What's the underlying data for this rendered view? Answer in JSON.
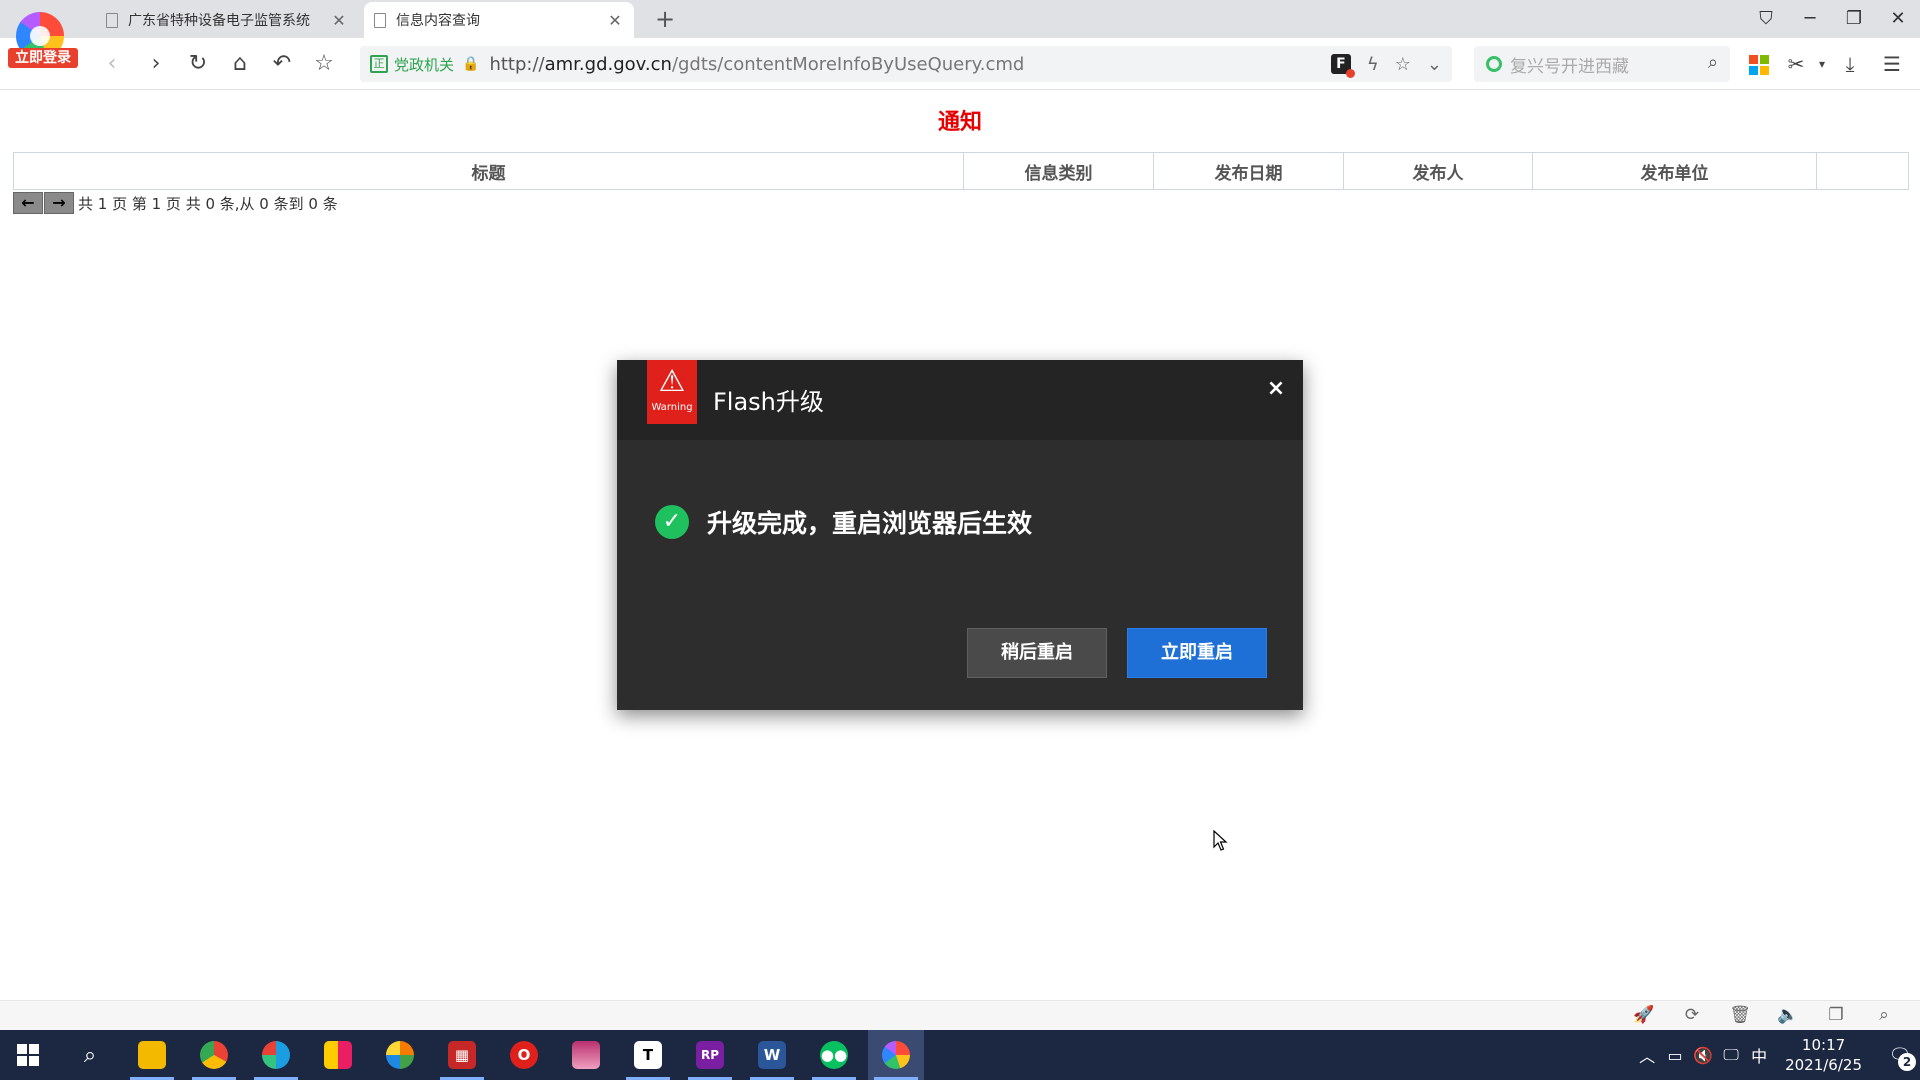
{
  "browser": {
    "login_badge": "立即登录",
    "tabs": [
      {
        "title": "广东省特种设备电子监管系统",
        "active": false
      },
      {
        "title": "信息内容查询",
        "active": true
      }
    ],
    "address": {
      "gov_label": "党政机关",
      "url_prefix": "http://",
      "url_domain": "amr.gd.gov.cn",
      "url_path": "/gdts/contentMoreInfoByUseQuery.cmd",
      "flash_badge": "F"
    },
    "search_placeholder": "复兴号开进西藏"
  },
  "page": {
    "title": "通知",
    "table_headers": [
      "标题",
      "信息类别",
      "发布日期",
      "发布人",
      "发布单位",
      ""
    ],
    "pager": {
      "prev": "←",
      "next": "→",
      "info": "共 1 页 第 1 页 共 0 条,从 0 条到 0 条"
    }
  },
  "dialog": {
    "badge_text": "Warning",
    "title": "Flash升级",
    "message": "升级完成，重启浏览器后生效",
    "later_button": "稍后重启",
    "now_button": "立即重启",
    "close": "×"
  },
  "taskbar": {
    "apps": [
      {
        "name": "file-explorer",
        "label": "",
        "color": "#f2b900"
      },
      {
        "name": "chrome",
        "label": "",
        "color": "#e94235"
      },
      {
        "name": "edge",
        "label": "",
        "color": "#1b9de2"
      },
      {
        "name": "tiles-app",
        "label": "",
        "color": "#ffcc00"
      },
      {
        "name": "pinwheel-app",
        "label": "",
        "color": "#f57c00"
      },
      {
        "name": "shield-app",
        "label": "",
        "color": "#c62828"
      },
      {
        "name": "opera",
        "label": "",
        "color": "#e0201b"
      },
      {
        "name": "winrar",
        "label": "",
        "color": "#b8306e"
      },
      {
        "name": "typora",
        "label": "T",
        "color": "#ffffff"
      },
      {
        "name": "axure-rp",
        "label": "RP",
        "color": "#7b1fa2"
      },
      {
        "name": "word",
        "label": "W",
        "color": "#2b579a"
      },
      {
        "name": "wechat",
        "label": "",
        "color": "#07c160"
      },
      {
        "name": "360-browser",
        "label": "",
        "color": "#ff6f00"
      }
    ],
    "ime": "中",
    "time": "10:17",
    "date": "2021/6/25",
    "notifications": "2"
  }
}
